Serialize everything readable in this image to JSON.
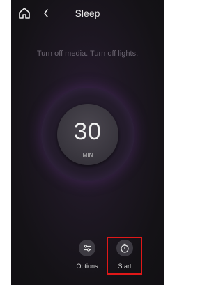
{
  "header": {
    "title": "Sleep",
    "home_icon": "home-icon",
    "back_icon": "chevron-left-icon"
  },
  "hint": "Turn off media. Turn off lights.",
  "timer": {
    "value": "30",
    "unit": "MIN"
  },
  "actions": {
    "options_label": "Options",
    "options_icon": "sliders-icon",
    "start_label": "Start",
    "start_icon": "timer-icon"
  },
  "colors": {
    "highlight": "#e01818",
    "ring_accent": "#6a3a8e"
  }
}
